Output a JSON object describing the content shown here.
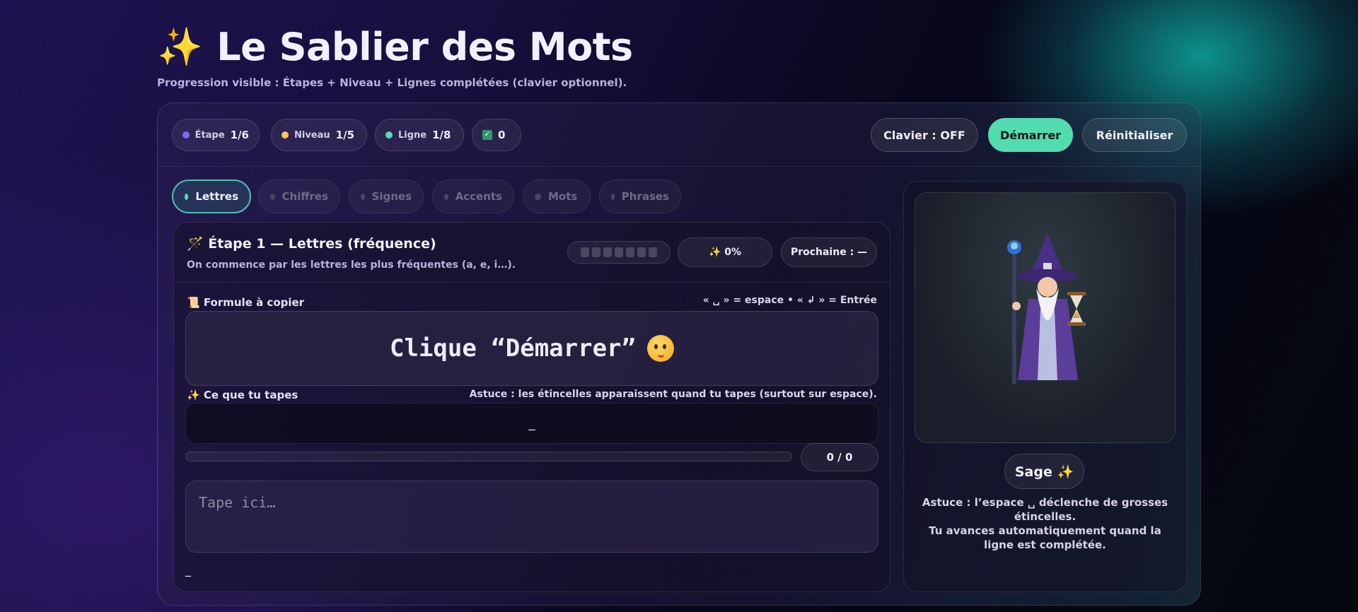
{
  "header": {
    "title_icon": "sparkles-icon",
    "title": "Le Sablier des Mots",
    "subtitle": "Progression visible : Étapes + Niveau + Lignes complétées (clavier optionnel)."
  },
  "status": {
    "stage": {
      "label": "Étape",
      "value": "1/6",
      "color": "#7a6cf0"
    },
    "level": {
      "label": "Niveau",
      "value": "1/5",
      "color": "#f5c95a"
    },
    "line": {
      "label": "Ligne",
      "value": "1/8",
      "color": "#52dcb0"
    },
    "completed": {
      "value": "0",
      "icon": "checkbox-icon"
    }
  },
  "actions": {
    "keyboard": "Clavier : OFF",
    "start": "Démarrer",
    "reset": "Réinitialiser"
  },
  "tabs": [
    {
      "label": "Lettres",
      "active": true
    },
    {
      "label": "Chiffres",
      "active": false
    },
    {
      "label": "Signes",
      "active": false
    },
    {
      "label": "Accents",
      "active": false
    },
    {
      "label": "Mots",
      "active": false
    },
    {
      "label": "Phrases",
      "active": false
    }
  ],
  "stage_card": {
    "icon": "magic-wand-icon",
    "title": "Étape 1 — Lettres (fréquence)",
    "description": "On commence par les lettres les plus fréquentes (a, e, i…).",
    "segments_total": 7,
    "segments_done": 0,
    "progress": "✨ 0%",
    "next": "Prochaine : —"
  },
  "formula": {
    "label": "📜 Formule à copier",
    "legend": "« ␣ » = espace • « ↲ » = Entrée",
    "text": "Clique “Démarrer”"
  },
  "typed": {
    "label": "✨ Ce que tu tapes",
    "hint": "Astuce : les étincelles apparaissent quand tu tapes (surtout sur espace).",
    "value": "_",
    "progress": 0,
    "count": "0 / 0"
  },
  "input": {
    "placeholder": "Tape ici…",
    "caret": "_"
  },
  "mascot": {
    "name": "Sage ✨",
    "tip1": "Astuce : l’espace ␣ déclenche de grosses étincelles.",
    "tip2": "Tu avances automatiquement quand la ligne est complétée."
  }
}
